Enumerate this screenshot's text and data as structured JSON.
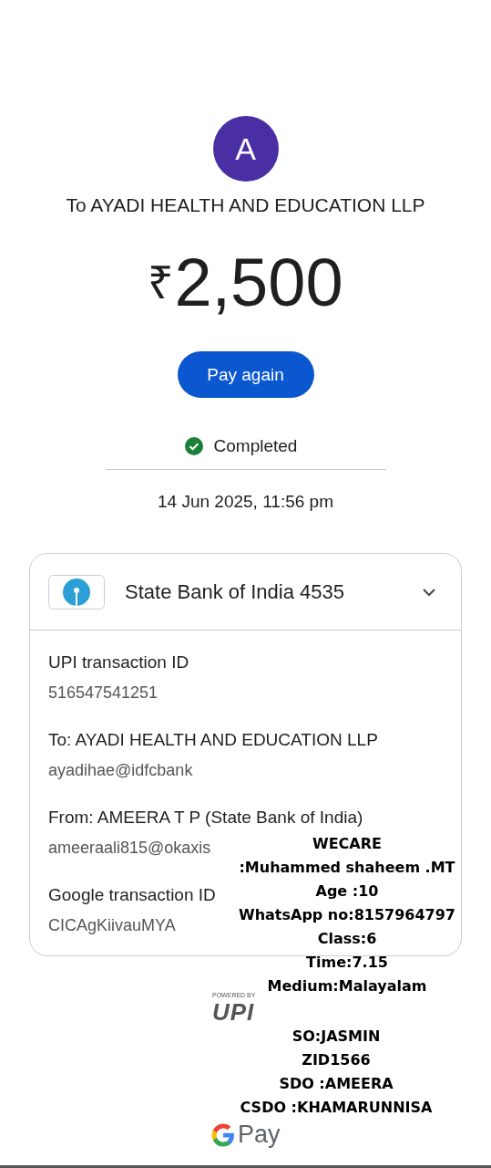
{
  "avatar": {
    "initial": "A"
  },
  "recipient_title": "To AYADI HEALTH AND EDUCATION LLP",
  "amount": {
    "currency": "₹",
    "value": "2,500"
  },
  "pay_again_button": "Pay again",
  "status": {
    "label": "Completed",
    "completed": true
  },
  "date_time": "14 Jun 2025, 11:56 pm",
  "account_card": {
    "bank": "State Bank of India 4535",
    "expanded": true,
    "details": [
      {
        "label": "UPI transaction ID",
        "value": "516547541251"
      },
      {
        "label": "To: AYADI HEALTH AND EDUCATION LLP",
        "value": "ayadihae@idfcbank"
      },
      {
        "label": "From: AMEERA  T P (State Bank of India)",
        "value": "ameeraali815@okaxis"
      },
      {
        "label": "Google transaction ID",
        "value": "CICAgKiivauMYA"
      }
    ]
  },
  "upi_badge": {
    "caption": "POWERED BY",
    "logo_text": "UPI"
  },
  "overlay_note": {
    "upper_lines": [
      "WECARE",
      ":Muhammed shaheem .MT",
      "Age :10",
      "WhatsApp no:8157964797",
      "Class:6",
      "Time:7.15",
      "Medium:Malayalam"
    ],
    "lower_lines": [
      "SO:JASMIN",
      "ZID1566",
      "SDO :AMEERA",
      "CSDO :KHAMARUNNISA"
    ]
  },
  "footer_brand": {
    "text": "Pay"
  }
}
